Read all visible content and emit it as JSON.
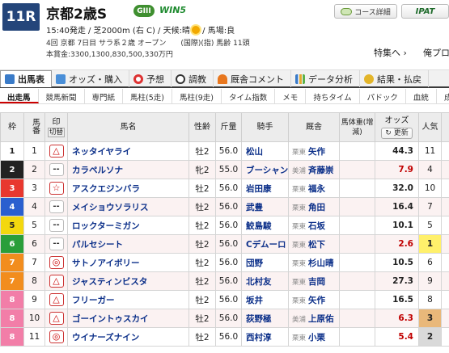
{
  "race": {
    "badge": "11R",
    "name": "京都2歳S",
    "grade": "GIII",
    "win5": "WIN5",
    "info_line1_prefix": "15:40発走 / 芝2000m (右 C) / 天候:晴",
    "info_line1_suffix": " / 馬場:良",
    "info_line2": "4回 京都 7日目 サラ系２歳 オープン　　(国際)(指) 馬齢 11頭",
    "info_line3": "本賞金:3300,1300,830,500,330万円"
  },
  "buttons": {
    "course": "コース詳細",
    "ipat": "IPAT"
  },
  "links": {
    "tokushu": "特集へ ›",
    "yoso": "俺プロ"
  },
  "main_tabs": [
    "出馬表",
    "オッズ・購入",
    "予想",
    "調教",
    "厩舎コメント",
    "データ分析",
    "結果・払戻"
  ],
  "sub_tabs": [
    "出走馬",
    "競馬新聞",
    "専門紙",
    "馬柱(5走)",
    "馬柱(9走)",
    "タイム指数",
    "メモ",
    "持ちタイム",
    "パドック",
    "血統",
    "成績"
  ],
  "headers": {
    "waku": "枠",
    "umaban": "馬番",
    "mark": "印",
    "mark_sub": "切替",
    "name": "馬名",
    "sex_age": "性齢",
    "weight": "斤量",
    "jockey": "騎手",
    "trainer": "厩舎",
    "body_weight": "馬体重(増減)",
    "odds": "オッズ",
    "update": "更新",
    "popularity": "人気"
  },
  "colors": {
    "accent": "#c00000",
    "navy": "#24457a"
  },
  "horses": [
    {
      "waku": "1",
      "umaban": "1",
      "mark": "triangle",
      "name": "ネッタイヤライ",
      "sex_age": "牡2",
      "weight": "56.0",
      "jockey": "松山",
      "region": "栗東",
      "trainer": "矢作",
      "odds": "44.3",
      "odds_color": "#222",
      "popularity": "11"
    },
    {
      "waku": "2",
      "umaban": "2",
      "mark": "dash",
      "name": "カラペルソナ",
      "sex_age": "牝2",
      "weight": "55.0",
      "jockey": "ブーシャン",
      "region": "美浦",
      "trainer": "斉藤崇",
      "odds": "7.9",
      "odds_color": "#c00000",
      "popularity": "4"
    },
    {
      "waku": "3",
      "umaban": "3",
      "mark": "star",
      "name": "アスクエジンバラ",
      "sex_age": "牡2",
      "weight": "56.0",
      "jockey": "岩田康",
      "region": "栗東",
      "trainer": "福永",
      "odds": "32.0",
      "odds_color": "#222",
      "popularity": "10"
    },
    {
      "waku": "4",
      "umaban": "4",
      "mark": "dash",
      "name": "メイショウソラリス",
      "sex_age": "牡2",
      "weight": "56.0",
      "jockey": "武豊",
      "region": "栗東",
      "trainer": "角田",
      "odds": "16.4",
      "odds_color": "#222",
      "popularity": "7"
    },
    {
      "waku": "5",
      "umaban": "5",
      "mark": "dash",
      "name": "ロックターミガン",
      "sex_age": "牡2",
      "weight": "56.0",
      "jockey": "鮫島駿",
      "region": "栗東",
      "trainer": "石坂",
      "odds": "10.1",
      "odds_color": "#222",
      "popularity": "5"
    },
    {
      "waku": "6",
      "umaban": "6",
      "mark": "dash",
      "name": "パルセシート",
      "sex_age": "牡2",
      "weight": "56.0",
      "jockey": "Cデムーロ",
      "region": "栗東",
      "trainer": "松下",
      "odds": "2.6",
      "odds_color": "#c00000",
      "popularity": "1"
    },
    {
      "waku": "7",
      "umaban": "7",
      "mark": "circle",
      "name": "サトノアイボリー",
      "sex_age": "牡2",
      "weight": "56.0",
      "jockey": "団野",
      "region": "栗東",
      "trainer": "杉山晴",
      "odds": "10.5",
      "odds_color": "#222",
      "popularity": "6"
    },
    {
      "waku": "7",
      "umaban": "8",
      "mark": "triangle",
      "name": "ジャスティンビスタ",
      "sex_age": "牡2",
      "weight": "56.0",
      "jockey": "北村友",
      "region": "栗東",
      "trainer": "吉岡",
      "odds": "27.3",
      "odds_color": "#222",
      "popularity": "9"
    },
    {
      "waku": "8",
      "umaban": "9",
      "mark": "triangle",
      "name": "フリーガー",
      "sex_age": "牡2",
      "weight": "56.0",
      "jockey": "坂井",
      "region": "栗東",
      "trainer": "矢作",
      "odds": "16.5",
      "odds_color": "#222",
      "popularity": "8"
    },
    {
      "waku": "8",
      "umaban": "10",
      "mark": "triangle",
      "name": "ゴーイントゥスカイ",
      "sex_age": "牡2",
      "weight": "56.0",
      "jockey": "荻野極",
      "region": "美浦",
      "trainer": "上原佑",
      "odds": "6.3",
      "odds_color": "#c00000",
      "popularity": "3"
    },
    {
      "waku": "8",
      "umaban": "11",
      "mark": "circle",
      "name": "ウイナーズナイン",
      "sex_age": "牡2",
      "weight": "56.0",
      "jockey": "西村淳",
      "region": "栗東",
      "trainer": "小栗",
      "odds": "5.4",
      "odds_color": "#c00000",
      "popularity": "2"
    }
  ]
}
